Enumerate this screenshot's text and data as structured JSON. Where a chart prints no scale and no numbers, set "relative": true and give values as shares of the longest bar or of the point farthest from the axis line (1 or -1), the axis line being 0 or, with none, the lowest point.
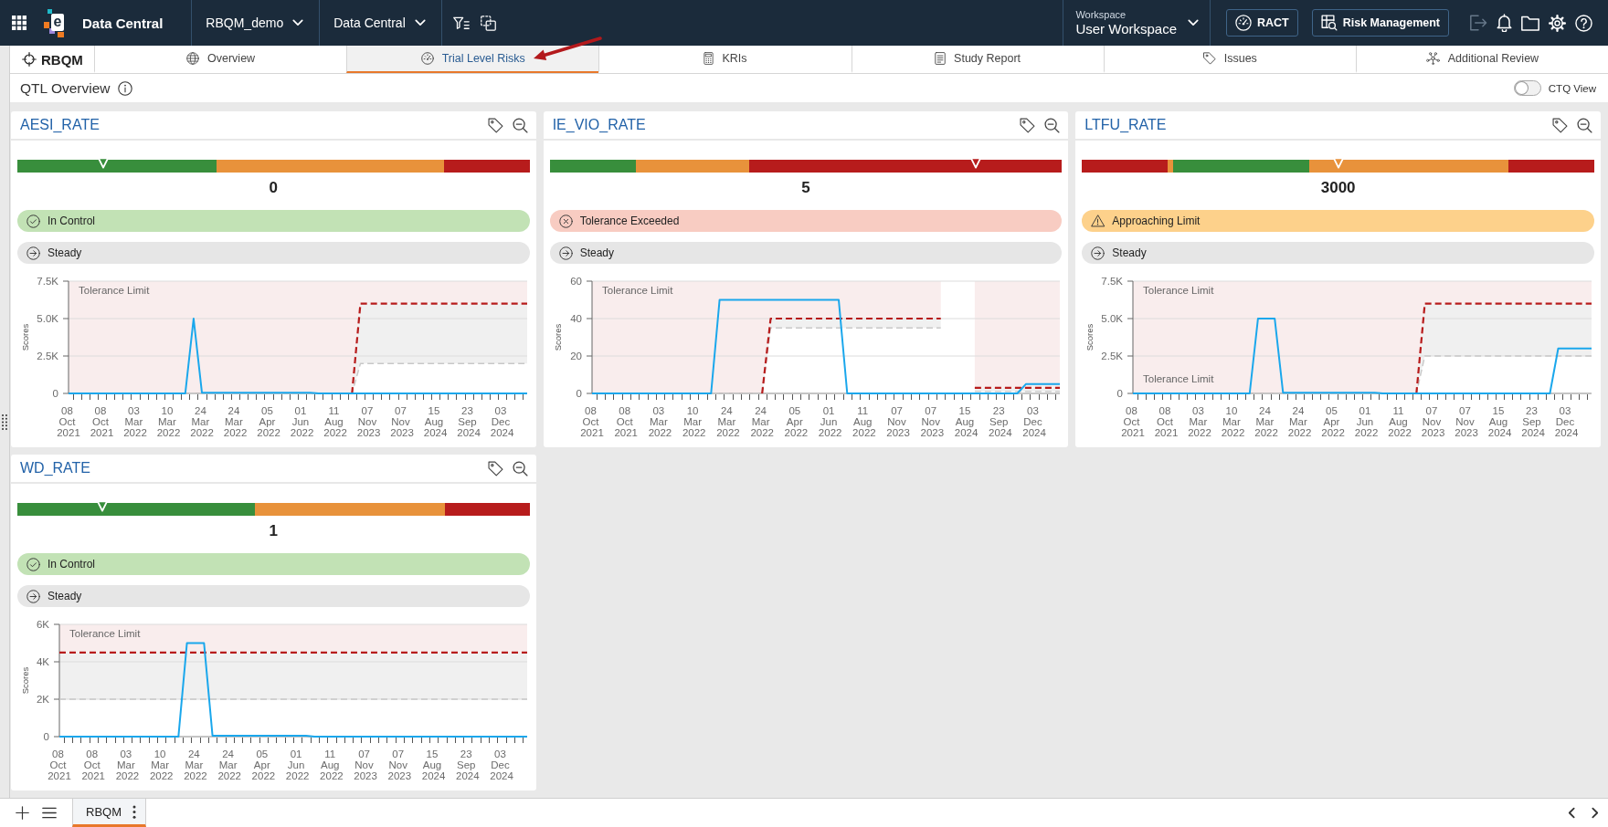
{
  "app_bar": {
    "logo": {
      "text": "e"
    },
    "title": "Data Central",
    "selectors": [
      {
        "label": "RBQM_demo"
      },
      {
        "label": "Data Central"
      }
    ],
    "workspace": {
      "label": "Workspace",
      "value": "User Workspace"
    },
    "buttons": [
      {
        "label": "RACT"
      },
      {
        "label": "Risk Management"
      }
    ],
    "tools": [
      {
        "disabled": true
      },
      {
        "disabled": false
      },
      {
        "disabled": false
      },
      {
        "disabled": false
      },
      {
        "disabled": false
      }
    ]
  },
  "module": {
    "label": "RBQM"
  },
  "tabs": [
    {
      "label": "Overview",
      "selected": false
    },
    {
      "label": "Trial Level Risks",
      "selected": true
    },
    {
      "label": "KRIs",
      "selected": false
    },
    {
      "label": "Study Report",
      "selected": false
    },
    {
      "label": "Issues",
      "selected": false
    },
    {
      "label": "Additional Review",
      "selected": false
    }
  ],
  "page": {
    "title": "QTL Overview",
    "ctq_view": {
      "label": "CTQ View",
      "on": false
    }
  },
  "cards": [
    {
      "title": "AESI_RATE",
      "gauge": {
        "chart_data": {
          "type": "bar",
          "orientation": "horizontal",
          "stacked": true,
          "relative": true,
          "series": [
            {
              "color": "#388e3c",
              "values": [
                0.388
              ]
            },
            {
              "color": "#e8923b",
              "values": [
                0.445
              ]
            },
            {
              "color": "#b71c1c",
              "values": [
                0.167
              ]
            }
          ]
        },
        "marker": {
          "level": 0.167
        },
        "value": "0"
      },
      "status": {
        "kind": "in_control",
        "label": "In Control"
      },
      "trend": {
        "kind": "steady",
        "label": "Steady"
      },
      "chart_data": {
        "type": "line",
        "ylabel": "Scores",
        "ylim": [
          0,
          7500
        ],
        "yticks": [
          {
            "value": 0,
            "label": "0"
          },
          {
            "value": 2500,
            "label": "2.5K"
          },
          {
            "value": 5000,
            "label": "5.0K"
          },
          {
            "value": 7500,
            "label": "7.5K"
          }
        ],
        "categories": [
          "08 Oct 2021",
          null,
          null,
          null,
          "08 Oct 2021",
          null,
          null,
          null,
          "03 Mar 2022",
          null,
          null,
          null,
          "10 Mar 2022",
          null,
          null,
          null,
          "24 Mar 2022",
          null,
          null,
          null,
          "24 Mar 2022",
          null,
          null,
          null,
          "05 Apr 2022",
          null,
          null,
          null,
          "01 Jun 2022",
          null,
          null,
          null,
          "11 Aug 2022",
          null,
          null,
          null,
          "07 Nov 2023",
          null,
          null,
          null,
          "07 Nov 2023",
          null,
          null,
          null,
          "15 Aug 2024",
          null,
          null,
          null,
          "23 Sep 2024",
          null,
          null,
          null,
          "03 Dec 2024",
          null,
          null,
          null
        ],
        "series": [
          {
            "color": "#1aa7ec",
            "values": [
              0,
              0,
              0,
              0,
              0,
              0,
              0,
              0,
              0,
              0,
              0,
              0,
              0,
              0,
              0,
              5000,
              50,
              50,
              50,
              50,
              50,
              50,
              50,
              50,
              50,
              50,
              50,
              50,
              50,
              50,
              0,
              0,
              0,
              0,
              0,
              0,
              0,
              0,
              0,
              0,
              0,
              0,
              0,
              0,
              0,
              0,
              0,
              0,
              0,
              0,
              0,
              0,
              0,
              0,
              0,
              0
            ]
          },
          {
            "color": "#b71c1c",
            "line_style": "dashed",
            "values": [
              null,
              null,
              null,
              null,
              null,
              null,
              null,
              null,
              null,
              null,
              null,
              null,
              null,
              null,
              null,
              null,
              null,
              null,
              null,
              null,
              null,
              null,
              null,
              null,
              null,
              null,
              null,
              null,
              null,
              null,
              null,
              null,
              null,
              null,
              0,
              6000,
              6000,
              6000,
              6000,
              6000,
              6000,
              6000,
              6000,
              6000,
              6000,
              6000,
              6000,
              6000,
              6000,
              6000,
              6000,
              6000,
              6000,
              6000,
              6000,
              6000
            ]
          },
          {
            "color": "#c8c8c8",
            "line_style": "dashed",
            "values": [
              0,
              0,
              0,
              0,
              0,
              0,
              0,
              0,
              0,
              0,
              0,
              0,
              0,
              0,
              0,
              0,
              0,
              0,
              0,
              0,
              0,
              0,
              0,
              0,
              0,
              0,
              0,
              0,
              0,
              0,
              0,
              0,
              0,
              0,
              0,
              2000,
              2000,
              2000,
              2000,
              2000,
              2000,
              2000,
              2000,
              2000,
              2000,
              2000,
              2000,
              2000,
              2000,
              2000,
              2000,
              2000,
              2000,
              2000,
              2000,
              2000
            ]
          }
        ],
        "annotations": [
          "Tolerance Limit"
        ]
      }
    },
    {
      "title": "IE_VIO_RATE",
      "gauge": {
        "chart_data": {
          "type": "bar",
          "orientation": "horizontal",
          "stacked": true,
          "relative": true,
          "series": [
            {
              "color": "#388e3c",
              "values": [
                0.167
              ]
            },
            {
              "color": "#e8923b",
              "values": [
                0.222
              ]
            },
            {
              "color": "#b71c1c",
              "values": [
                0.611
              ]
            }
          ]
        },
        "marker": {
          "level": 0.832
        },
        "value": "5"
      },
      "status": {
        "kind": "exceeded",
        "label": "Tolerance Exceeded"
      },
      "trend": {
        "kind": "steady",
        "label": "Steady"
      },
      "chart_data": {
        "type": "line",
        "ylabel": "Scores",
        "ylim": [
          0,
          60
        ],
        "yticks": [
          0,
          20,
          40,
          60
        ],
        "categories": [
          "08 Oct 2021",
          null,
          null,
          null,
          "08 Oct 2021",
          null,
          null,
          null,
          "03 Mar 2022",
          null,
          null,
          null,
          "10 Mar 2022",
          null,
          null,
          null,
          "24 Mar 2022",
          null,
          null,
          null,
          "24 Mar 2022",
          null,
          null,
          null,
          "05 Apr 2022",
          null,
          null,
          null,
          "01 Jun 2022",
          null,
          null,
          null,
          "11 Aug 2022",
          null,
          null,
          null,
          "07 Nov 2023",
          null,
          null,
          null,
          "07 Nov 2023",
          null,
          null,
          null,
          "15 Aug 2024",
          null,
          null,
          null,
          "23 Sep 2024",
          null,
          null,
          null,
          "03 Dec 2024",
          null,
          null,
          null
        ],
        "series": [
          {
            "color": "#1aa7ec",
            "values": [
              0,
              0,
              0,
              0,
              0,
              0,
              0,
              0,
              0,
              0,
              0,
              0,
              0,
              0,
              0,
              50,
              50,
              50,
              50,
              50,
              50,
              50,
              50,
              50,
              50,
              50,
              50,
              50,
              50,
              50,
              0,
              0,
              0,
              0,
              0,
              0,
              0,
              0,
              0,
              0,
              0,
              0,
              0,
              0,
              0,
              0,
              0,
              0,
              0,
              0,
              0,
              5,
              5,
              5,
              5,
              5
            ]
          },
          {
            "color": "#b71c1c",
            "line_style": "dashed",
            "values": [
              null,
              null,
              null,
              null,
              null,
              null,
              null,
              null,
              null,
              null,
              null,
              null,
              null,
              null,
              null,
              null,
              null,
              null,
              null,
              null,
              0,
              40,
              40,
              40,
              40,
              40,
              40,
              40,
              40,
              40,
              40,
              40,
              40,
              40,
              40,
              40,
              40,
              40,
              40,
              40,
              40,
              40,
              null,
              null,
              null,
              3,
              3,
              3,
              3,
              3,
              3,
              3,
              3,
              3,
              3,
              3
            ]
          },
          {
            "color": "#c8c8c8",
            "line_style": "dashed",
            "values": [
              0,
              0,
              0,
              0,
              0,
              0,
              0,
              0,
              0,
              0,
              0,
              0,
              0,
              0,
              0,
              0,
              0,
              0,
              0,
              0,
              0,
              35,
              35,
              35,
              35,
              35,
              35,
              35,
              35,
              35,
              35,
              35,
              35,
              35,
              35,
              35,
              35,
              35,
              35,
              35,
              35,
              35,
              null,
              null,
              null,
              1,
              1,
              1,
              1,
              1,
              1,
              1,
              1,
              1,
              1,
              1
            ]
          }
        ],
        "annotations": [
          "Tolerance Limit"
        ]
      }
    },
    {
      "title": "LTFU_RATE",
      "gauge": {
        "chart_data": {
          "type": "bar",
          "orientation": "horizontal",
          "stacked": true,
          "relative": true,
          "series": [
            {
              "color": "#b71c1c",
              "values": [
                0.167
              ]
            },
            {
              "color": "#e8923b",
              "values": [
                0.011
              ]
            },
            {
              "color": "#388e3c",
              "values": [
                0.266
              ]
            },
            {
              "color": "#e8923b",
              "values": [
                0.389
              ]
            },
            {
              "color": "#b71c1c",
              "values": [
                0.167
              ]
            }
          ]
        },
        "marker": {
          "level": 0.5
        },
        "value": "3000"
      },
      "status": {
        "kind": "approaching",
        "label": "Approaching Limit"
      },
      "trend": {
        "kind": "steady",
        "label": "Steady"
      },
      "chart_data": {
        "type": "line",
        "ylabel": "Scores",
        "ylim": [
          0,
          7500
        ],
        "yticks": [
          {
            "value": 0,
            "label": "0"
          },
          {
            "value": 2500,
            "label": "2.5K"
          },
          {
            "value": 5000,
            "label": "5.0K"
          },
          {
            "value": 7500,
            "label": "7.5K"
          }
        ],
        "categories": [
          "08 Oct 2021",
          null,
          null,
          null,
          "08 Oct 2021",
          null,
          null,
          null,
          "03 Mar 2022",
          null,
          null,
          null,
          "10 Mar 2022",
          null,
          null,
          null,
          "24 Mar 2022",
          null,
          null,
          null,
          "24 Mar 2022",
          null,
          null,
          null,
          "05 Apr 2022",
          null,
          null,
          null,
          "01 Jun 2022",
          null,
          null,
          null,
          "11 Aug 2022",
          null,
          null,
          null,
          "07 Nov 2023",
          null,
          null,
          null,
          "07 Nov 2023",
          null,
          null,
          null,
          "15 Aug 2024",
          null,
          null,
          null,
          "23 Sep 2024",
          null,
          null,
          null,
          "03 Dec 2024",
          null,
          null,
          null
        ],
        "series": [
          {
            "color": "#1aa7ec",
            "values": [
              0,
              0,
              0,
              0,
              0,
              0,
              0,
              0,
              0,
              0,
              0,
              0,
              0,
              0,
              0,
              5000,
              5000,
              5000,
              50,
              50,
              50,
              50,
              50,
              50,
              50,
              50,
              50,
              50,
              50,
              50,
              0,
              0,
              0,
              0,
              0,
              0,
              0,
              0,
              0,
              0,
              0,
              0,
              0,
              0,
              0,
              0,
              0,
              0,
              0,
              0,
              0,
              3000,
              3000,
              3000,
              3000,
              3000
            ]
          },
          {
            "color": "#b71c1c",
            "line_style": "dashed",
            "values": [
              null,
              null,
              null,
              null,
              null,
              null,
              null,
              null,
              null,
              null,
              null,
              null,
              null,
              null,
              null,
              null,
              null,
              null,
              null,
              null,
              null,
              null,
              null,
              null,
              null,
              null,
              null,
              null,
              null,
              null,
              null,
              null,
              null,
              null,
              0,
              6000,
              6000,
              6000,
              6000,
              6000,
              6000,
              6000,
              6000,
              6000,
              6000,
              6000,
              6000,
              6000,
              6000,
              6000,
              6000,
              6000,
              6000,
              6000,
              6000,
              6000
            ]
          },
          {
            "color": "#c8c8c8",
            "line_style": "dashed",
            "values": [
              0,
              0,
              0,
              0,
              0,
              0,
              0,
              0,
              0,
              0,
              0,
              0,
              0,
              0,
              0,
              0,
              0,
              0,
              0,
              0,
              0,
              0,
              0,
              0,
              0,
              0,
              0,
              0,
              0,
              0,
              0,
              0,
              0,
              0,
              0,
              2500,
              2500,
              2500,
              2500,
              2500,
              2500,
              2500,
              2500,
              2500,
              2500,
              2500,
              2500,
              2500,
              2500,
              2500,
              2500,
              2500,
              2500,
              2500,
              2500,
              2500
            ]
          }
        ],
        "annotations": [
          "Tolerance Limit",
          "Tolerance Limit"
        ]
      }
    },
    {
      "title": "WD_RATE",
      "gauge": {
        "chart_data": {
          "type": "bar",
          "orientation": "horizontal",
          "stacked": true,
          "relative": true,
          "series": [
            {
              "color": "#388e3c",
              "values": [
                0.463
              ]
            },
            {
              "color": "#e8923b",
              "values": [
                0.371
              ]
            },
            {
              "color": "#b71c1c",
              "values": [
                0.166
              ]
            }
          ]
        },
        "marker": {
          "level": 0.166
        },
        "value": "1"
      },
      "status": {
        "kind": "in_control",
        "label": "In Control"
      },
      "trend": {
        "kind": "steady",
        "label": "Steady"
      },
      "chart_data": {
        "type": "line",
        "ylabel": "Scores",
        "ylim": [
          0,
          6000
        ],
        "yticks": [
          {
            "value": 0,
            "label": "0"
          },
          {
            "value": 2000,
            "label": "2K"
          },
          {
            "value": 4000,
            "label": "4K"
          },
          {
            "value": 6000,
            "label": "6K"
          }
        ],
        "categories": [
          "08 Oct 2021",
          null,
          null,
          null,
          "08 Oct 2021",
          null,
          null,
          null,
          "03 Mar 2022",
          null,
          null,
          null,
          "10 Mar 2022",
          null,
          null,
          null,
          "24 Mar 2022",
          null,
          null,
          null,
          "24 Mar 2022",
          null,
          null,
          null,
          "05 Apr 2022",
          null,
          null,
          null,
          "01 Jun 2022",
          null,
          null,
          null,
          "11 Aug 2022",
          null,
          null,
          null,
          "07 Nov 2023",
          null,
          null,
          null,
          "07 Nov 2023",
          null,
          null,
          null,
          "15 Aug 2024",
          null,
          null,
          null,
          "23 Sep 2024",
          null,
          null,
          null,
          "03 Dec 2024",
          null,
          null,
          null
        ],
        "series": [
          {
            "color": "#1aa7ec",
            "values": [
              0,
              0,
              0,
              0,
              0,
              0,
              0,
              0,
              0,
              0,
              0,
              0,
              0,
              0,
              0,
              5000,
              5000,
              5000,
              50,
              50,
              50,
              50,
              50,
              50,
              50,
              50,
              50,
              50,
              50,
              50,
              0,
              0,
              0,
              0,
              0,
              0,
              0,
              0,
              0,
              0,
              0,
              0,
              0,
              0,
              0,
              0,
              0,
              0,
              0,
              0,
              0,
              0,
              0,
              0,
              0,
              0
            ]
          },
          {
            "color": "#b71c1c",
            "line_style": "dashed",
            "values": [
              4500,
              4500,
              4500,
              4500,
              4500,
              4500,
              4500,
              4500,
              4500,
              4500,
              4500,
              4500,
              4500,
              4500,
              4500,
              4500,
              4500,
              4500,
              4500,
              4500,
              4500,
              4500,
              4500,
              4500,
              4500,
              4500,
              4500,
              4500,
              4500,
              4500,
              4500,
              4500,
              4500,
              4500,
              4500,
              4500,
              4500,
              4500,
              4500,
              4500,
              4500,
              4500,
              4500,
              4500,
              4500,
              4500,
              4500,
              4500,
              4500,
              4500,
              4500,
              4500,
              4500,
              4500,
              4500,
              4500
            ]
          },
          {
            "color": "#c8c8c8",
            "line_style": "dashed",
            "values": [
              2000,
              2000,
              2000,
              2000,
              2000,
              2000,
              2000,
              2000,
              2000,
              2000,
              2000,
              2000,
              2000,
              2000,
              2000,
              2000,
              2000,
              2000,
              2000,
              2000,
              2000,
              2000,
              2000,
              2000,
              2000,
              2000,
              2000,
              2000,
              2000,
              2000,
              2000,
              2000,
              2000,
              2000,
              2000,
              2000,
              2000,
              2000,
              2000,
              2000,
              2000,
              2000,
              2000,
              2000,
              2000,
              2000,
              2000,
              2000,
              2000,
              2000,
              2000,
              2000,
              2000,
              2000,
              2000,
              2000
            ]
          }
        ],
        "annotations": [
          "Tolerance Limit"
        ]
      }
    }
  ],
  "bottom_bar": {
    "tabs": [
      {
        "label": "RBQM",
        "selected": true
      }
    ]
  }
}
